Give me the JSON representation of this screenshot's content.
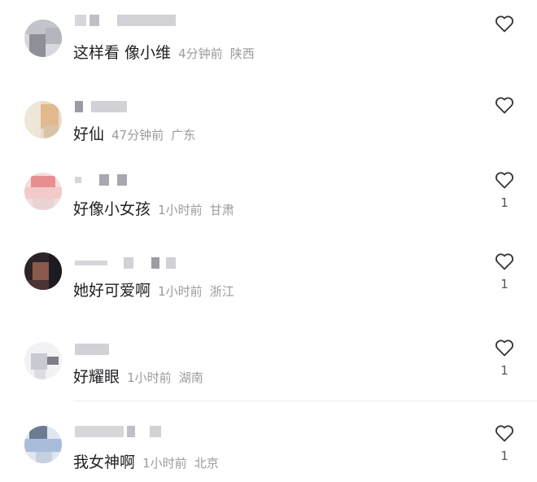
{
  "comments": [
    {
      "text": "这样看 像小维",
      "time": "4分钟前",
      "location": "陕西",
      "likes": "",
      "avatar_color": "#b8bac3"
    },
    {
      "text": "好仙",
      "time": "47分钟前",
      "location": "广东",
      "likes": "",
      "avatar_color": "#e7c9a8"
    },
    {
      "text": "好像小女孩",
      "time": "1小时前",
      "location": "甘肃",
      "likes": "1",
      "avatar_color": "#e9a8a8"
    },
    {
      "text": "她好可爱啊",
      "time": "1小时前",
      "location": "浙江",
      "likes": "1",
      "avatar_color": "#3a2a2a"
    },
    {
      "text": "好耀眼",
      "time": "1小时前",
      "location": "湖南",
      "likes": "1",
      "avatar_color": "#c9c9d2"
    },
    {
      "text": "我女神啊",
      "time": "1小时前",
      "location": "北京",
      "likes": "1",
      "avatar_color": "#9fb2cf"
    }
  ],
  "icons": {
    "like": "heart-outline-icon"
  },
  "colors": {
    "text": "#1f1f24",
    "meta": "#9a9aa0",
    "icon": "#333333"
  }
}
